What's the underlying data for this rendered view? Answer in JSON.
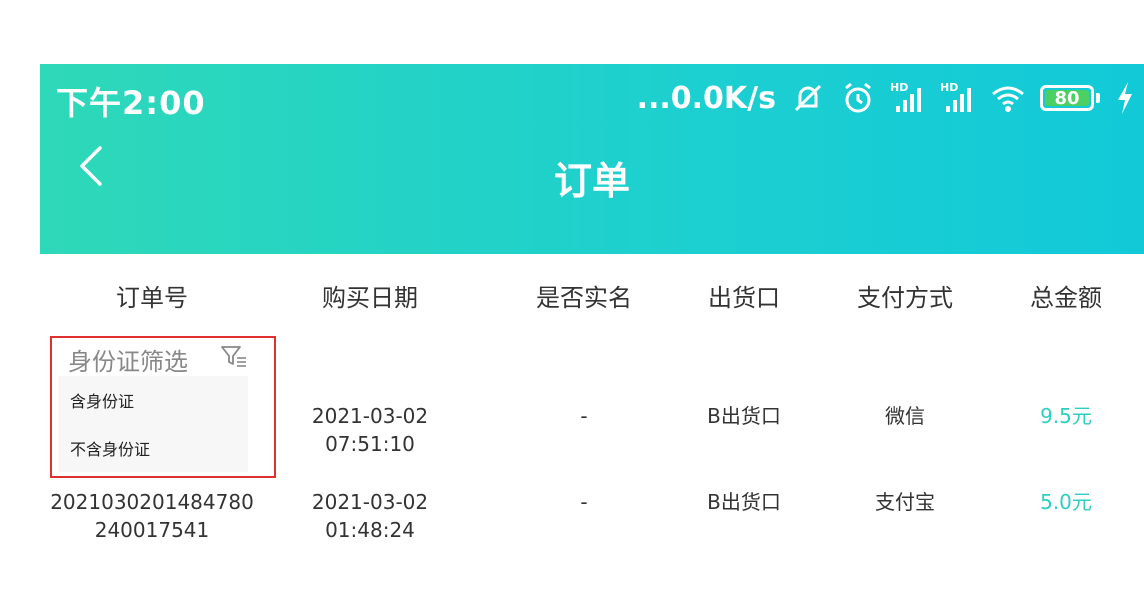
{
  "status": {
    "time": "下午2:00",
    "network_speed": "...0.0K/s",
    "battery_level": "80",
    "icons": [
      "mute-bell-icon",
      "alarm-icon",
      "hd-signal-icon",
      "hd-signal-icon",
      "wifi-icon",
      "charging-icon"
    ]
  },
  "header": {
    "title": "订单",
    "back_icon": "chevron-left-icon"
  },
  "table": {
    "columns": [
      "订单号",
      "购买日期",
      "是否实名",
      "出货口",
      "支付方式",
      "总金额"
    ],
    "rows": [
      {
        "date": "2021-03-02",
        "time": "07:51:10",
        "realname": "-",
        "outlet": "B出货口",
        "pay": "微信",
        "amount": "9.5元"
      },
      {
        "order_line1": "2021030201484780",
        "order_line2": "240017541",
        "date": "2021-03-02",
        "time": "01:48:24",
        "realname": "-",
        "outlet": "B出货口",
        "pay": "支付宝",
        "amount": "5.0元"
      }
    ]
  },
  "filter": {
    "label": "身份证筛选",
    "icon": "filter-icon",
    "options": [
      "含身份证",
      "不含身份证"
    ]
  },
  "colors": {
    "header_start": "#2ed8b8",
    "header_end": "#12c9d8",
    "amount": "#2ccfc0",
    "highlight_border": "#e0302f"
  }
}
